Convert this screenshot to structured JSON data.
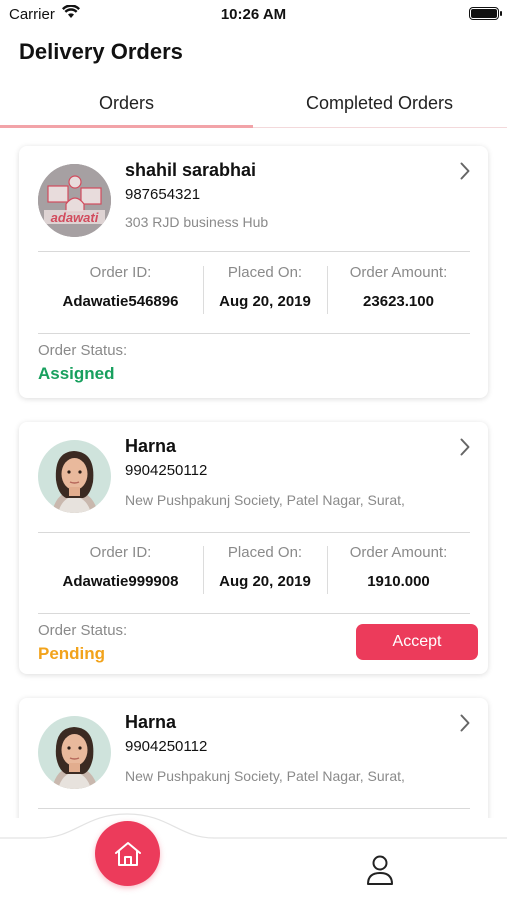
{
  "status_bar": {
    "carrier": "Carrier",
    "time": "10:26 AM",
    "battery_level": 1.0
  },
  "header": {
    "title": "Delivery Orders"
  },
  "tabs": [
    {
      "label": "Orders",
      "active": true
    },
    {
      "label": "Completed Orders",
      "active": false
    }
  ],
  "labels": {
    "order_id": "Order ID:",
    "placed_on": "Placed On:",
    "order_amount": "Order Amount:",
    "order_status": "Order Status:"
  },
  "orders": [
    {
      "name": "shahil sarabhai",
      "phone": "987654321",
      "address": "303 RJD business Hub",
      "avatar_text": "adawati",
      "order_id": "Adawatie546896",
      "placed_on": "Aug 20, 2019",
      "amount": "23623.100",
      "status": "Assigned",
      "status_color": "#18a05e"
    },
    {
      "name": "Harna",
      "phone": "9904250112",
      "address": "New Pushpakunj Society, Patel Nagar, Surat,",
      "order_id": "Adawatie999908",
      "placed_on": "Aug 20, 2019",
      "amount": "1910.000",
      "status": "Pending",
      "status_color": "#f2a31b",
      "action_label": "Accept"
    },
    {
      "name": "Harna",
      "phone": "9904250112",
      "address": "New Pushpakunj Society, Patel Nagar, Surat,"
    }
  ],
  "colors": {
    "accent": "#ec3b5b",
    "tab_indicator": "#f2a3a8"
  },
  "bottom_nav": {
    "home_icon": "home-icon",
    "profile_icon": "user-icon"
  }
}
